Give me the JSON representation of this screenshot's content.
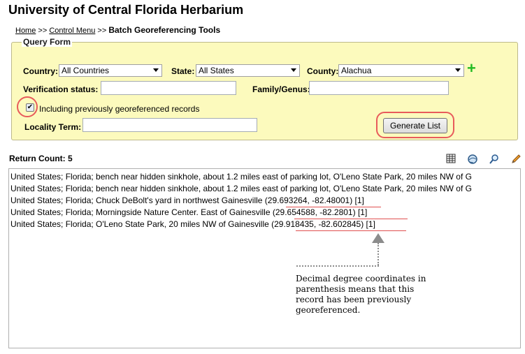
{
  "header": {
    "title": "University of Central Florida Herbarium"
  },
  "breadcrumb": {
    "home": "Home",
    "sep1": " >> ",
    "control_menu": "Control Menu",
    "sep2": " >> ",
    "current": "Batch Georeferencing Tools"
  },
  "query_form": {
    "legend": "Query Form",
    "country_label": "Country:",
    "country_value": "All Countries",
    "state_label": "State:",
    "state_value": "All States",
    "county_label": "County:",
    "county_value": "Alachua",
    "verification_label": "Verification status:",
    "verification_value": "",
    "family_label": "Family/Genus:",
    "family_value": "",
    "including_checkbox_label": "Including previously georeferenced records",
    "including_checked": true,
    "locality_label": "Locality Term:",
    "locality_value": "",
    "generate_button": "Generate List",
    "add_icon": "plus-icon"
  },
  "results": {
    "return_count_label": "Return Count: 5",
    "tools": [
      "table-icon",
      "globe-icon",
      "magnifier-icon",
      "pencil-icon"
    ],
    "rows": [
      "United States; Florida; bench near hidden sinkhole, about 1.2 miles east of parking lot, O'Leno State Park, 20 miles NW of G",
      "United States; Florida; bench near hidden sinkhole, about 1.2 miles east of parking lot, O'Leno State Park, 20 miles NW of G",
      "United States; Florida; Chuck DeBolt's yard in northwest Gainesville (29.693264, -82.48001) [1]",
      "United States; Florida; Morningside Nature Center. East of Gainesville (29.654588, -82.2801) [1]",
      "United States; Florida; O'Leno State Park, 20 miles NW of Gainesville (29.918435, -82.602845) [1]"
    ]
  },
  "annotation": {
    "note": "Decimal degree coordinates in parenthesis means that this record has been previously georeferenced."
  },
  "colors": {
    "form_background": "#fcfabd",
    "highlight_ring": "#e85b5b",
    "plus_icon": "#22bb22"
  }
}
